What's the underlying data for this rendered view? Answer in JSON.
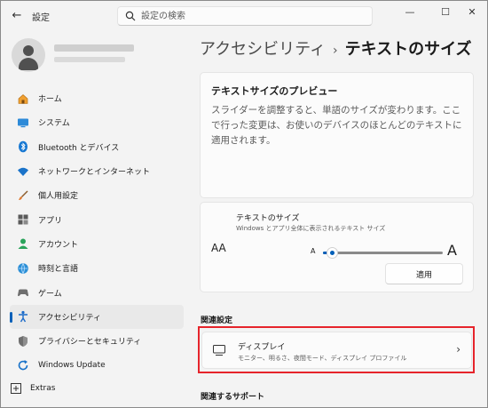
{
  "window": {
    "back_glyph": "←",
    "title": "設定",
    "controls": {
      "minimize": "—",
      "maximize": "☐",
      "close": "✕"
    }
  },
  "search": {
    "placeholder": "設定の検索",
    "value": ""
  },
  "sidebar": {
    "items": [
      {
        "label": "ホーム",
        "icon": "home-icon"
      },
      {
        "label": "システム",
        "icon": "system-icon"
      },
      {
        "label": "Bluetooth とデバイス",
        "icon": "bluetooth-icon"
      },
      {
        "label": "ネットワークとインターネット",
        "icon": "network-icon"
      },
      {
        "label": "個人用設定",
        "icon": "personalization-icon"
      },
      {
        "label": "アプリ",
        "icon": "apps-icon"
      },
      {
        "label": "アカウント",
        "icon": "account-icon"
      },
      {
        "label": "時刻と言語",
        "icon": "time-language-icon"
      },
      {
        "label": "ゲーム",
        "icon": "gaming-icon"
      },
      {
        "label": "アクセシビリティ",
        "icon": "accessibility-icon",
        "active": true
      },
      {
        "label": "プライバシーとセキュリティ",
        "icon": "shield-icon"
      },
      {
        "label": "Windows Update",
        "icon": "update-icon"
      }
    ],
    "extras": {
      "label": "Extras",
      "icon": "extras-icon"
    }
  },
  "breadcrumb": {
    "parent": "アクセシビリティ",
    "separator": "›",
    "current": "テキストのサイズ"
  },
  "preview": {
    "title": "テキストサイズのプレビュー",
    "text": "スライダーを調整すると、単語のサイズが変わります。ここで行った変更は、お使いのデバイスのほとんどのテキストに適用されます。"
  },
  "text_size": {
    "icon_label": "AA",
    "title": "テキストのサイズ",
    "subtitle": "Windows とアプリ全体に表示されるテキスト サイズ",
    "slider_min_label": "A",
    "slider_max_label": "A",
    "slider_value_percent": 100,
    "slider_min_percent": 100,
    "slider_max_percent": 225,
    "apply_label": "適用"
  },
  "related_settings": {
    "heading": "関連設定",
    "display": {
      "title": "ディスプレイ",
      "subtitle": "モニター、明るさ、夜間モード、ディスプレイ プロファイル",
      "chevron": "›"
    }
  },
  "related_support": {
    "heading": "関連するサポート"
  },
  "colors": {
    "accent": "#005fb8",
    "highlight_box": "#e6242b",
    "background": "#f3f3f3",
    "card": "#fbfbfb"
  }
}
